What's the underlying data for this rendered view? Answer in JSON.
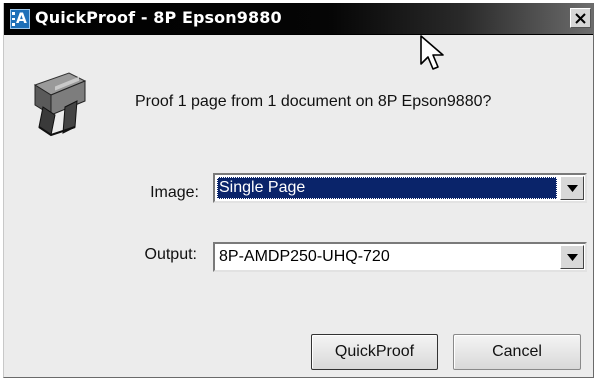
{
  "window": {
    "title": "QuickProof - 8P Epson9880",
    "app_icon_letter": "A"
  },
  "dialog": {
    "prompt": "Proof 1 page from 1 document on 8P Epson9880?",
    "image_label": "Image:",
    "image_value": "Single Page",
    "output_label": "Output:",
    "output_value": "8P-AMDP250-UHQ-720"
  },
  "buttons": {
    "quickproof": "QuickProof",
    "cancel": "Cancel"
  },
  "colors": {
    "titlebar": "#000000",
    "selection": "#0a246a",
    "dialog_bg": "#ececec"
  },
  "icons": [
    "app-logo-icon",
    "close-icon",
    "mouse-cursor-icon",
    "printer-icon",
    "dropdown-arrow-icon"
  ]
}
